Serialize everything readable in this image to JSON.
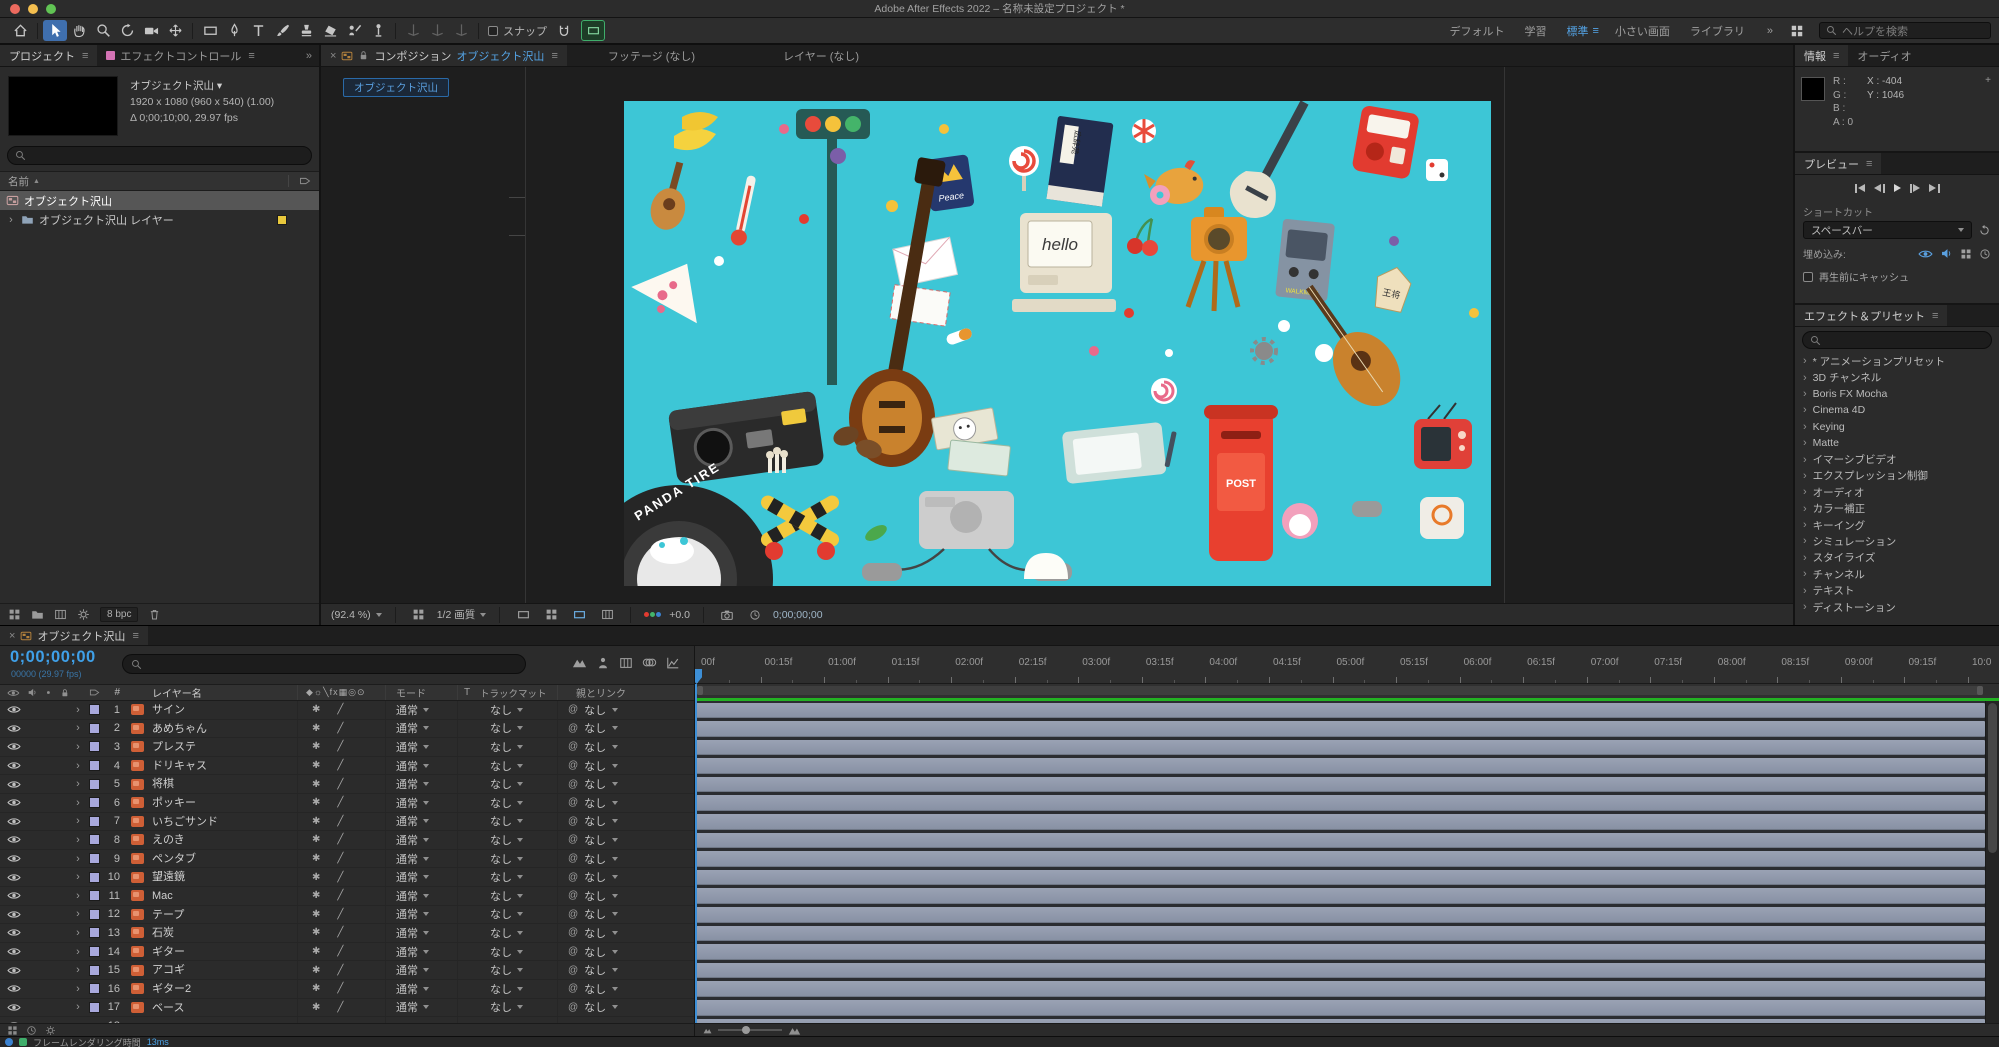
{
  "titlebar": {
    "title": "Adobe After Effects 2022 – 名称未設定プロジェクト *"
  },
  "toolbar": {
    "snap_label": "スナップ",
    "workspaces": [
      "デフォルト",
      "学習",
      "標準",
      "小さい画面",
      "ライブラリ"
    ],
    "active_workspace": "標準",
    "search_placeholder": "ヘルプを検索"
  },
  "glyphs": {
    "close": "×",
    "menu": "≡",
    "more": "»",
    "chevron": "›",
    "sort": "▲",
    "hash": "#",
    "switches_header": "◆☼╲fx▦◎⊙",
    "collapse": "✱",
    "quality": "╱",
    "pickwhip": "@",
    "crosshair": "+"
  },
  "project": {
    "tab": "プロジェクト",
    "tab2": "エフェクトコントロール",
    "comp_name": "オブジェクト沢山",
    "comp_info1": "1920 x 1080 (960 x 540) (1.00)",
    "comp_info2": "Δ 0;00;10;00, 29.97 fps",
    "name_column": "名前",
    "items": [
      {
        "label": "オブジェクト沢山",
        "type": "comp"
      },
      {
        "label": "オブジェクト沢山 レイヤー",
        "type": "folder"
      }
    ],
    "bpc": "8 bpc"
  },
  "viewer": {
    "tab_label": "コンポジション",
    "tab_comp": "オブジェクト沢山",
    "tab_footage": "フッテージ (なし)",
    "tab_layer": "レイヤー (なし)",
    "comp_tag": "オブジェクト沢山",
    "zoom": "(92.4 %)",
    "quality": "1/2 画質",
    "exposure": "+0.0",
    "timecode": "0;00;00;00",
    "illustration": {
      "mac_text": "hello",
      "post_text": "POST",
      "tire_text": "PANDA TIRE",
      "walkman_text": "WALKMAN",
      "book_text": "広辞苑",
      "peace_text": "Peace",
      "shogi_text": "王将"
    }
  },
  "info": {
    "tab": "情報",
    "tab2": "オーディオ",
    "r": "R :",
    "g": "G :",
    "b": "B :",
    "a": "A :  0",
    "x": "X : -404",
    "y": "Y : 1046"
  },
  "preview": {
    "title": "プレビュー",
    "shortcut_label": "ショートカット",
    "shortcut_value": "スペースバー",
    "include_label": "埋め込み:",
    "cache_label": "再生前にキャッシュ"
  },
  "effects": {
    "title": "エフェクト＆プリセット",
    "items": [
      "* アニメーションプリセット",
      "3D チャンネル",
      "Boris FX Mocha",
      "Cinema 4D",
      "Keying",
      "Matte",
      "イマーシブビデオ",
      "エクスプレッション制御",
      "オーディオ",
      "カラー補正",
      "キーイング",
      "シミュレーション",
      "スタイライズ",
      "チャンネル",
      "テキスト",
      "ディストーション"
    ]
  },
  "timeline": {
    "tab": "オブジェクト沢山",
    "timecode": "0;00;00;00",
    "frame_info": "00000 (29.97 fps)",
    "col_layer_name": "レイヤー名",
    "col_mode": "モード",
    "col_t": "T",
    "col_trackmatte": "トラックマット",
    "col_parent": "親とリンク",
    "mode_value": "通常",
    "none_value": "なし",
    "layers": [
      "サイン",
      "あめちゃん",
      "プレステ",
      "ドリキャス",
      "将棋",
      "ポッキー",
      "いちごサンド",
      "えのき",
      "ペンタブ",
      "望遠鏡",
      "Mac",
      "テープ",
      "石炭",
      "ギター",
      "アコギ",
      "ギター2",
      "ベース"
    ],
    "ruler_labels": [
      "00f",
      "00:15f",
      "01:00f",
      "01:15f",
      "02:00f",
      "02:15f",
      "03:00f",
      "03:15f",
      "04:00f",
      "04:15f",
      "05:00f",
      "05:15f",
      "06:00f",
      "06:15f",
      "07:00f",
      "07:15f",
      "08:00f",
      "08:15f",
      "09:00f",
      "09:15f",
      "10:0"
    ]
  },
  "statusbar": {
    "label": "フレームレンダリング時間",
    "value": "13ms"
  },
  "colors": {
    "accent_blue": "#3fa0e8",
    "cache_green": "#23b223",
    "canvas_cyan": "#3dc6d6",
    "label_lavender": "#a8a8dc",
    "label_yellow": "#e8c83c"
  }
}
